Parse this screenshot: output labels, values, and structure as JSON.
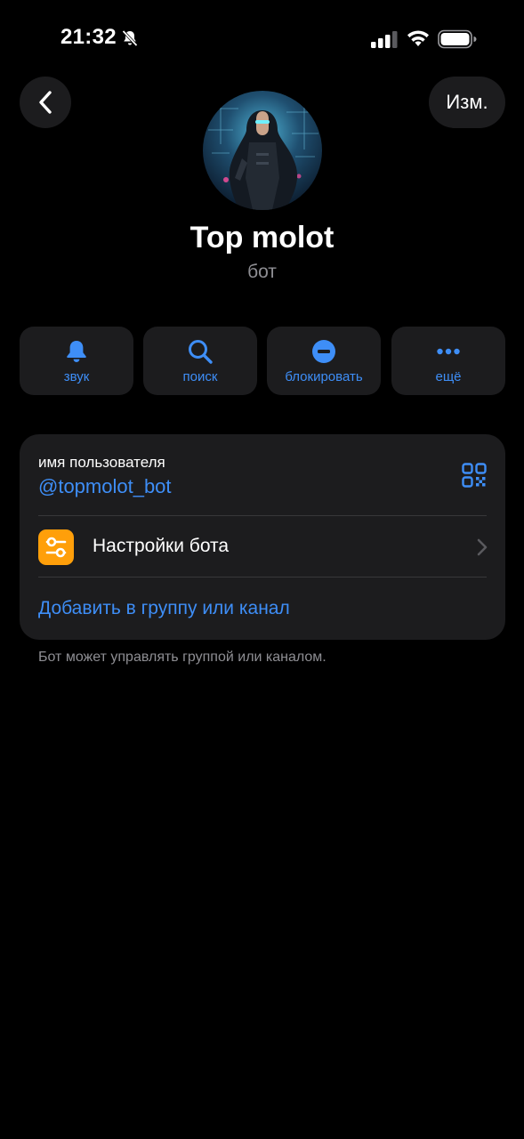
{
  "status_bar": {
    "time": "21:32",
    "icons": [
      "bell-slash-icon",
      "signal-icon",
      "wifi-icon",
      "battery-icon"
    ]
  },
  "header": {
    "back_icon": "chevron-left-icon",
    "edit_label": "Изм."
  },
  "profile": {
    "name": "Top molot",
    "subtitle": "бот"
  },
  "actions": [
    {
      "label": "звук",
      "icon": "bell-icon"
    },
    {
      "label": "поиск",
      "icon": "search-icon"
    },
    {
      "label": "блокировать",
      "icon": "block-icon"
    },
    {
      "label": "ещё",
      "icon": "more-icon"
    }
  ],
  "info": {
    "username_caption": "имя пользователя",
    "username_value": "@topmolot_bot",
    "qr_icon": "qr-code-icon",
    "settings_label": "Настройки бота",
    "add_link": "Добавить в группу или канал"
  },
  "footnote": "Бот может управлять группой или каналом.",
  "colors": {
    "background": "#000000",
    "surface": "#1c1c1e",
    "accent": "#3e8ef7",
    "secondary_text": "#8e8e93",
    "settings_icon_bg": "#ff9f0a"
  }
}
